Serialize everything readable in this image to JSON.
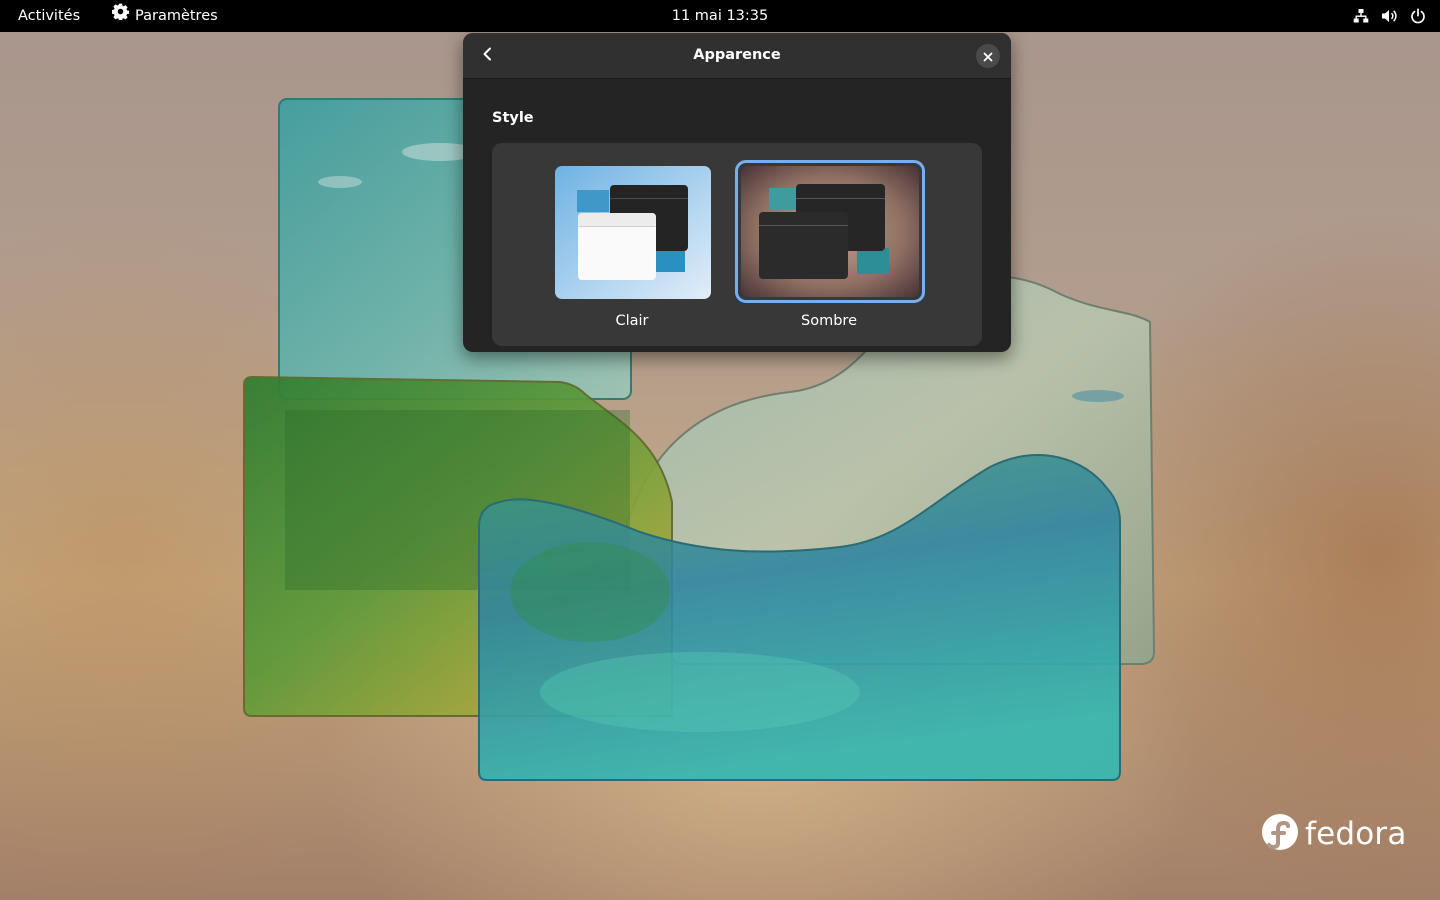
{
  "topbar": {
    "activities": "Activités",
    "app_menu_label": "Paramètres",
    "app_menu_icon": "gear-icon",
    "clock": "11 mai  13:35",
    "status_icons": [
      "network-wired-icon",
      "volume-icon",
      "power-icon"
    ]
  },
  "dialog": {
    "title": "Apparence",
    "back_icon": "chevron-left-icon",
    "close_icon": "close-icon",
    "section_label": "Style",
    "options": [
      {
        "label": "Clair",
        "selected": false
      },
      {
        "label": "Sombre",
        "selected": true
      }
    ],
    "accent_color": "#78aeed"
  },
  "branding": {
    "logo_text": "fedora"
  }
}
